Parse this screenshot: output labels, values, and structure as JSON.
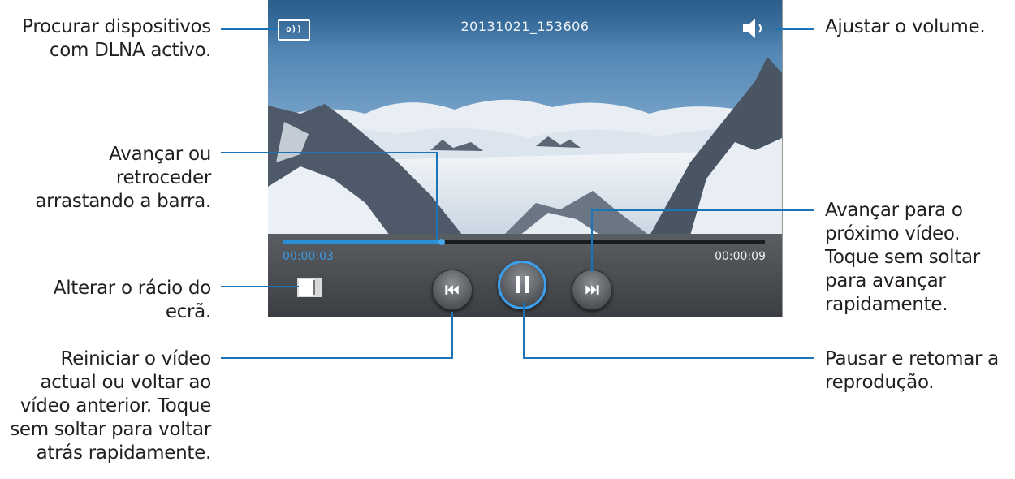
{
  "player": {
    "file_title": "20131021_153606",
    "dlna_icon_text": "o))",
    "time_current": "00:00:03",
    "time_total": "00:00:09",
    "progress_fraction": 0.33,
    "accent_color": "#2b8fd8",
    "icons": {
      "dlna": "dlna-screen-icon",
      "volume": "speaker-volume-icon",
      "ratio": "aspect-ratio-icon",
      "prev": "skip-previous-icon",
      "pause": "pause-icon",
      "next": "skip-next-icon"
    }
  },
  "callouts": {
    "dlna": [
      "Procurar dispositivos",
      "com DLNA activo."
    ],
    "seek": [
      "Avançar ou",
      "retroceder",
      "arrastando a barra."
    ],
    "ratio": [
      "Alterar o rácio do",
      "ecrã."
    ],
    "prev": [
      "Reiniciar o vídeo",
      "actual ou voltar ao",
      "vídeo anterior. Toque",
      "sem soltar para voltar",
      "atrás rapidamente."
    ],
    "volume": [
      "Ajustar o volume."
    ],
    "next": [
      "Avançar para o",
      "próximo vídeo.",
      "Toque sem soltar",
      "para avançar",
      "rapidamente."
    ],
    "pause": [
      "Pausar e retomar a",
      "reprodução."
    ]
  }
}
